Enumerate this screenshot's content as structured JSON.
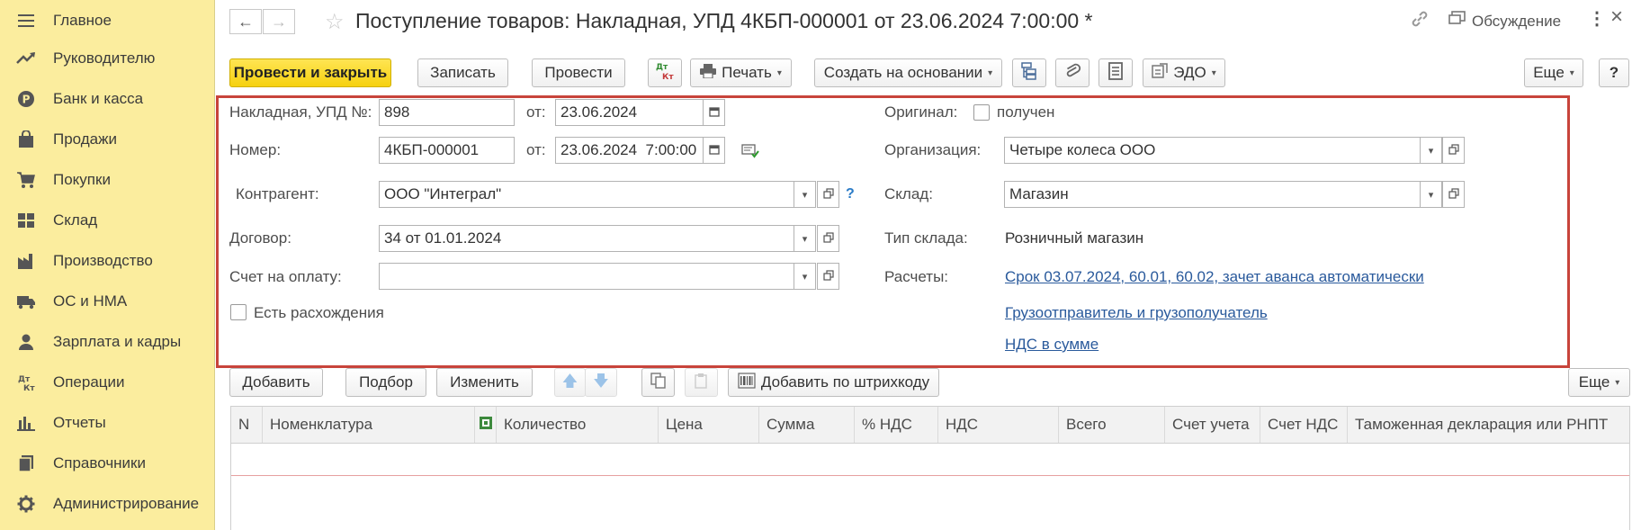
{
  "sidebar": {
    "items": [
      {
        "label": "Главное",
        "icon": "menu-icon"
      },
      {
        "label": "Руководителю",
        "icon": "trend-icon"
      },
      {
        "label": "Банк и касса",
        "icon": "ruble-icon"
      },
      {
        "label": "Продажи",
        "icon": "bag-icon"
      },
      {
        "label": "Покупки",
        "icon": "cart-icon"
      },
      {
        "label": "Склад",
        "icon": "warehouse-icon"
      },
      {
        "label": "Производство",
        "icon": "factory-icon"
      },
      {
        "label": "ОС и НМА",
        "icon": "truck-icon"
      },
      {
        "label": "Зарплата и кадры",
        "icon": "person-icon"
      },
      {
        "label": "Операции",
        "icon": "dt-kt-icon"
      },
      {
        "label": "Отчеты",
        "icon": "bar-chart-icon"
      },
      {
        "label": "Справочники",
        "icon": "book-icon"
      },
      {
        "label": "Администрирование",
        "icon": "gear-icon"
      }
    ]
  },
  "header": {
    "title": "Поступление товаров: Накладная, УПД 4КБП-000001 от 23.06.2024 7:00:00 *",
    "discussion": "Обсуждение",
    "close": "×"
  },
  "toolbar": {
    "post_and_close": "Провести и закрыть",
    "save": "Записать",
    "post": "Провести",
    "dt_kt": "Дт Кт",
    "print": "Печать",
    "create_based_on": "Создать на основании",
    "edo": "ЭДО",
    "more": "Еще",
    "help": "?"
  },
  "form": {
    "invoice_label": "Накладная, УПД №:",
    "invoice_number": "898",
    "from_label": "от:",
    "invoice_date": "23.06.2024",
    "number_label": "Номер:",
    "number": "4КБП-000001",
    "number_date": "23.06.2024  7:00:00",
    "counterparty_label": "Контрагент:",
    "counterparty": "ООО \"Интеграл\"",
    "contract_label": "Договор:",
    "contract": "34 от 01.01.2024",
    "payment_invoice_label": "Счет на оплату:",
    "payment_invoice": "",
    "discrepancies_label": "Есть расхождения",
    "original_label": "Оригинал:",
    "original_received": "получен",
    "organization_label": "Организация:",
    "organization": "Четыре колеса ООО",
    "warehouse_label": "Склад:",
    "warehouse": "Магазин",
    "warehouse_type_label": "Тип склада:",
    "warehouse_type": "Розничный магазин",
    "settlements_label": "Расчеты:",
    "settlements_link": "Срок 03.07.2024, 60.01, 60.02, зачет аванса автоматически",
    "shipper_link": "Грузоотправитель и грузополучатель",
    "vat_link": "НДС в сумме",
    "help_mark": "?"
  },
  "table_toolbar": {
    "add": "Добавить",
    "pick": "Подбор",
    "edit": "Изменить",
    "add_barcode": "Добавить по штрихкоду",
    "more": "Еще"
  },
  "table": {
    "columns": [
      "N",
      "Номенклатура",
      "Количество",
      "Цена",
      "Сумма",
      "% НДС",
      "НДС",
      "Всего",
      "Счет учета",
      "Счет НДС",
      "Таможенная декларация или РНПТ"
    ]
  }
}
